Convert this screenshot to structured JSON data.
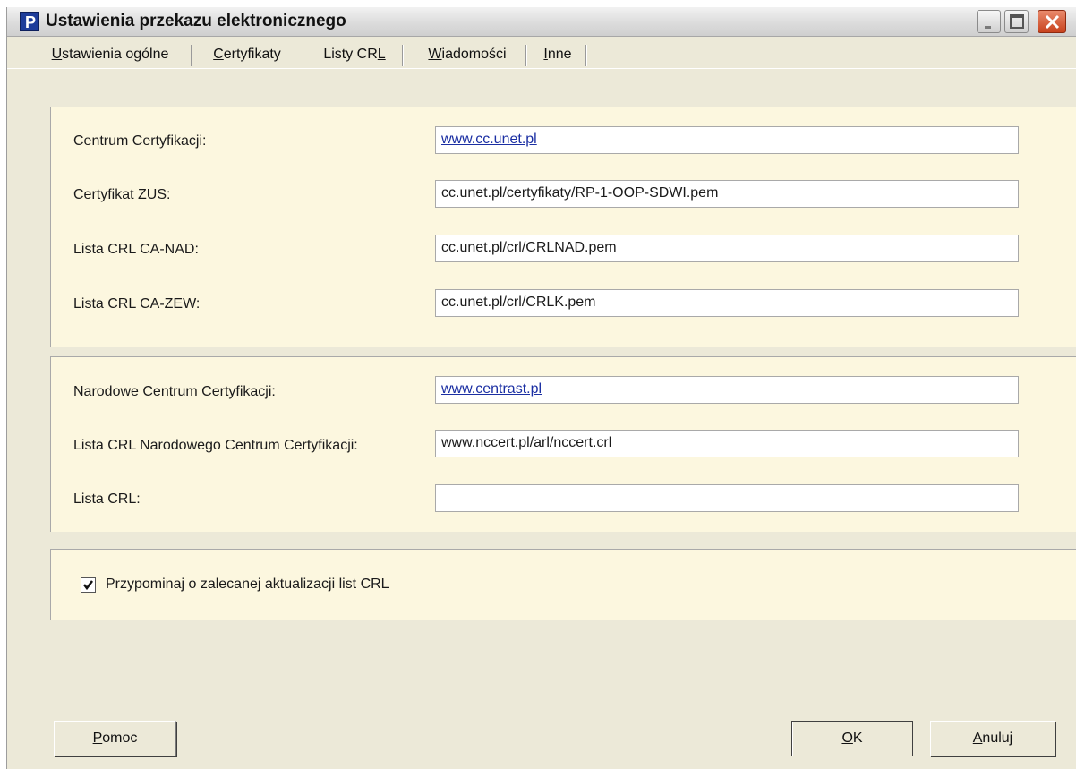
{
  "window": {
    "title": "Ustawienia przekazu elektronicznego",
    "icon": "app-p-icon"
  },
  "tabs": [
    {
      "label": "Ustawienia ogólne",
      "accel": "U",
      "rest": "stawienia ogólne"
    },
    {
      "label": "Certyfikaty",
      "accel": "C",
      "rest": "ertyfikaty"
    },
    {
      "label": "Listy CRL",
      "pre": "Listy CR",
      "accel": "L",
      "active": true
    },
    {
      "label": "Wiadomości",
      "accel": "W",
      "rest": "iadomości"
    },
    {
      "label": "Inne",
      "accel": "I",
      "rest": "nne"
    }
  ],
  "group1": {
    "rows": [
      {
        "label": "Centrum Certyfikacji:",
        "value": "www.cc.unet.pl"
      },
      {
        "label": "Certyfikat ZUS:",
        "value": "cc.unet.pl/certyfikaty/RP-1-OOP-SDWI.pem"
      },
      {
        "label": "Lista CRL CA-NAD:",
        "value": "cc.unet.pl/crl/CRLNAD.pem"
      },
      {
        "label": "Lista CRL CA-ZEW:",
        "value": "cc.unet.pl/crl/CRLK.pem"
      }
    ]
  },
  "group2": {
    "rows": [
      {
        "label": "Narodowe Centrum Certyfikacji:",
        "value": "www.centrast.pl"
      },
      {
        "label": "Lista CRL Narodowego Centrum Certyfikacji:",
        "value": "www.nccert.pl/arl/nccert.crl"
      },
      {
        "label": "Lista CRL:",
        "value": ""
      }
    ]
  },
  "reminder": {
    "label": "Przypominaj o zalecanej aktualizacji list CRL",
    "checked": true
  },
  "buttons": {
    "help": {
      "label": "Pomoc",
      "accel": "P",
      "rest": "omoc"
    },
    "ok": {
      "label": "OK",
      "accel": "O",
      "rest": "K"
    },
    "cancel": {
      "label": "Anuluj",
      "accel": "A",
      "rest": "nuluj"
    }
  },
  "colors": {
    "panel_bg": "#fcf7df",
    "window_bg": "#ece9d8",
    "link": "#1b2fa3"
  }
}
